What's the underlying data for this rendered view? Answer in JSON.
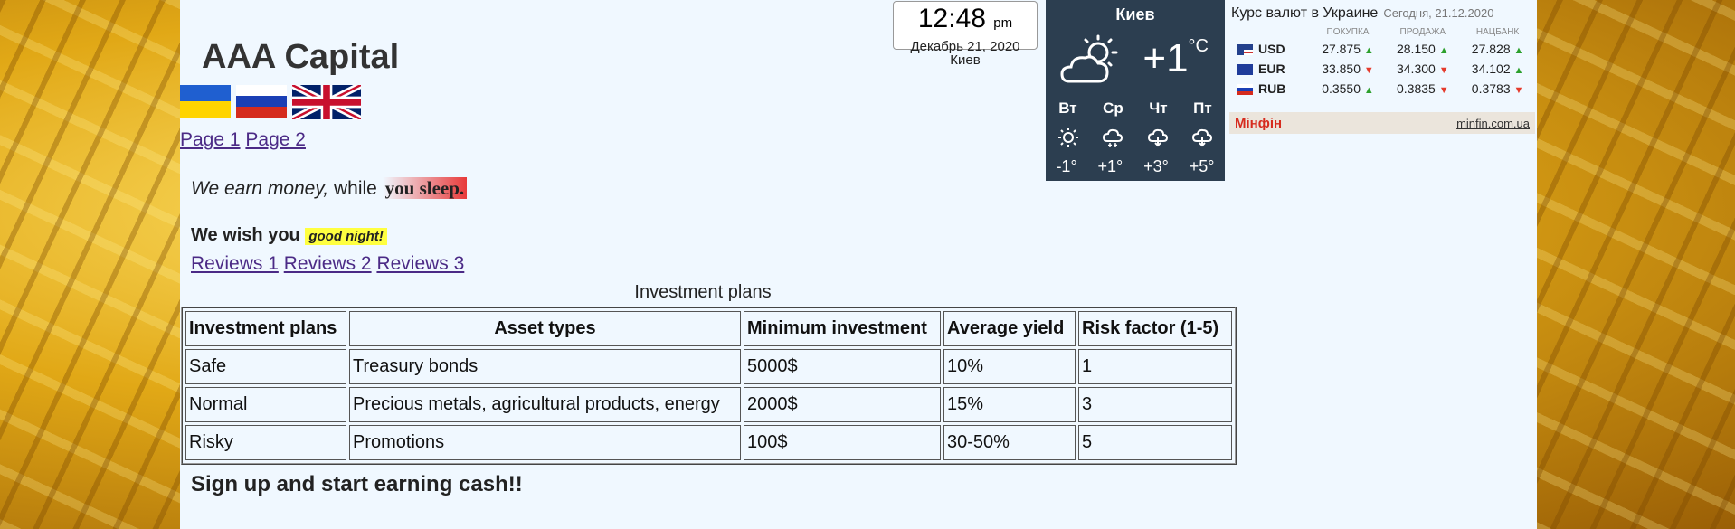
{
  "site": {
    "title": "AAA Capital",
    "flags": [
      "Ukraine",
      "Russia",
      "United Kingdom"
    ],
    "nav_pages": [
      "Page 1",
      "Page 2"
    ],
    "tagline": {
      "part1": "We earn money,",
      "part2": " while ",
      "part3": "you sleep."
    },
    "wish": {
      "text": "We wish you ",
      "highlight": "good night!"
    },
    "reviews": [
      "Reviews 1",
      "Reviews 2",
      "Reviews 3"
    ],
    "table_caption": "Investment plans",
    "table": {
      "headers": [
        "Investment plans",
        "Asset types",
        "Minimum investment",
        "Average yield",
        "Risk factor (1-5)"
      ],
      "rows": [
        [
          "Safe",
          "Treasury bonds",
          "5000$",
          "10%",
          "1"
        ],
        [
          "Normal",
          "Precious metals, agricultural products, energy",
          "2000$",
          "15%",
          "3"
        ],
        [
          "Risky",
          "Promotions",
          "100$",
          "30-50%",
          "5"
        ]
      ]
    },
    "signup": "Sign up and start earning cash!!"
  },
  "clock": {
    "time": "12:48",
    "ampm": "pm",
    "date": "Декабрь 21, 2020",
    "city": "Киев"
  },
  "weather": {
    "city": "Киев",
    "temp": "+1",
    "unit": "°C",
    "days": [
      "Вт",
      "Ср",
      "Чт",
      "Пт"
    ],
    "icons": [
      "sun-icon",
      "snow-cloud-icon",
      "rain-cloud-icon",
      "rain-cloud-icon"
    ],
    "temps": [
      "-1°",
      "+1°",
      "+3°",
      "+5°"
    ]
  },
  "currency": {
    "title": "Курс валют в Украине",
    "today": "Сегодня, 21.12.2020",
    "cols": [
      "ПОКУПКА",
      "ПРОДАЖА",
      "НАЦБАНК"
    ],
    "rows": [
      {
        "code": "USD",
        "buy": "27.875",
        "sell": "28.150",
        "nbu": "27.828",
        "dir": [
          "up",
          "up",
          "up"
        ]
      },
      {
        "code": "EUR",
        "buy": "33.850",
        "sell": "34.300",
        "nbu": "34.102",
        "dir": [
          "down",
          "down",
          "up"
        ]
      },
      {
        "code": "RUB",
        "buy": "0.3550",
        "sell": "0.3835",
        "nbu": "0.3783",
        "dir": [
          "up",
          "down",
          "down"
        ]
      }
    ],
    "brand": "Мінфін",
    "site": "minfin.com.ua"
  },
  "colors": {
    "accent_red": "#d62b1e",
    "weather_bg": "#2c3e50",
    "page_bg": "#f0f8ff",
    "highlight": "#ffff40"
  }
}
